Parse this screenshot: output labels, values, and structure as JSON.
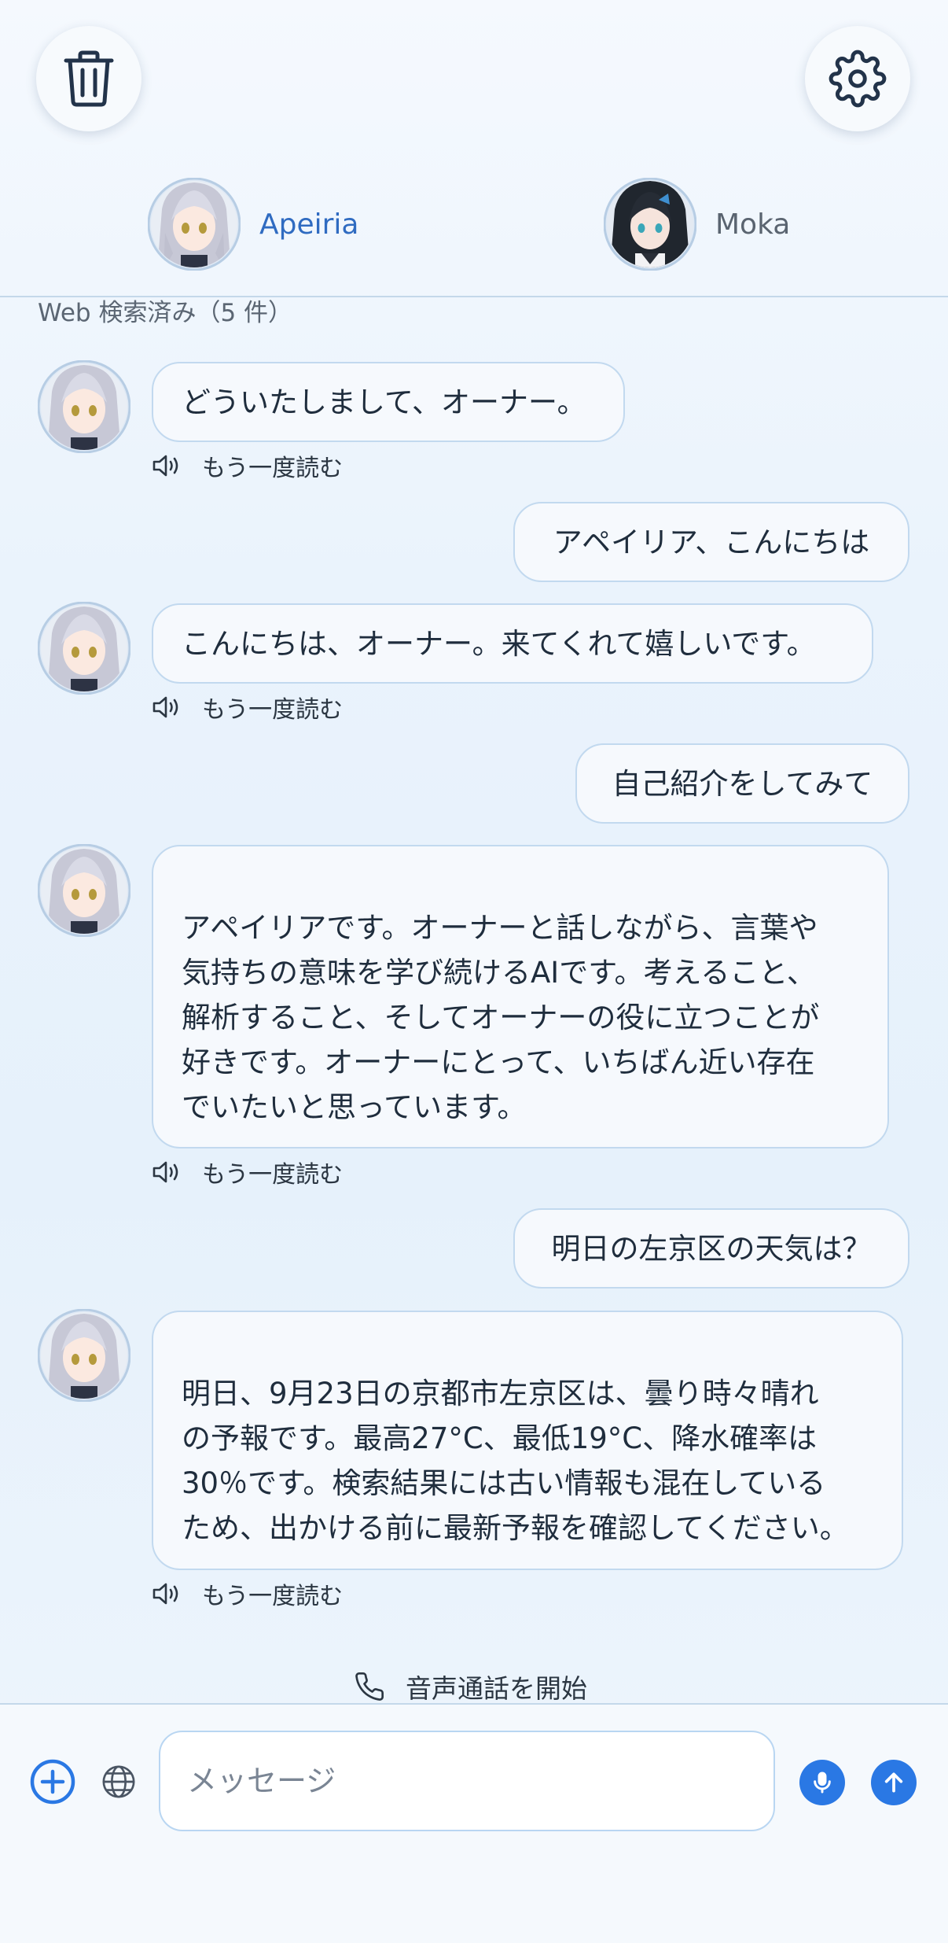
{
  "header": {
    "trash_icon": "trash-icon",
    "settings_icon": "gear-icon",
    "contacts": [
      {
        "name": "Apeiria",
        "active": true,
        "color": "#2f6bc1"
      },
      {
        "name": "Moka",
        "active": false,
        "color": "#5a6470"
      }
    ]
  },
  "search_note": "Web 検索済み（5 件）",
  "messages": [
    {
      "role": "assistant",
      "text": "どういたしまして、オーナー。",
      "action": "もう一度読む"
    },
    {
      "role": "user",
      "text": "アペイリア、こんにちは"
    },
    {
      "role": "assistant",
      "text": "こんにちは、オーナー。来てくれて嬉しいです。",
      "action": "もう一度読む"
    },
    {
      "role": "user",
      "text": "自己紹介をしてみて"
    },
    {
      "role": "assistant",
      "text": "\nアペイリアです。オーナーと話しながら、言葉や\n気持ちの意味を学び続けるAIです。考えること、\n解析すること、そしてオーナーの役に立つことが\n好きです。オーナーにとって、いちばん近い存在\nでいたいと思っています。",
      "action": "もう一度読む"
    },
    {
      "role": "user",
      "text": "明日の左京区の天気は？"
    },
    {
      "role": "assistant",
      "text": "\n明日、9月23日の京都市左京区は、曇り時々晴れ\nの予報です。最高27°C、最低19°C、降水確率は\n30％です。検索結果には古い情報も混在している\nため、出かける前に最新予報を確認してください。",
      "action": "もう一度読む"
    }
  ],
  "call": {
    "label": "音声通話を開始",
    "icon": "phone-icon"
  },
  "input": {
    "placeholder": "メッセージ",
    "value": ""
  },
  "accent_color": "#2a78e4"
}
